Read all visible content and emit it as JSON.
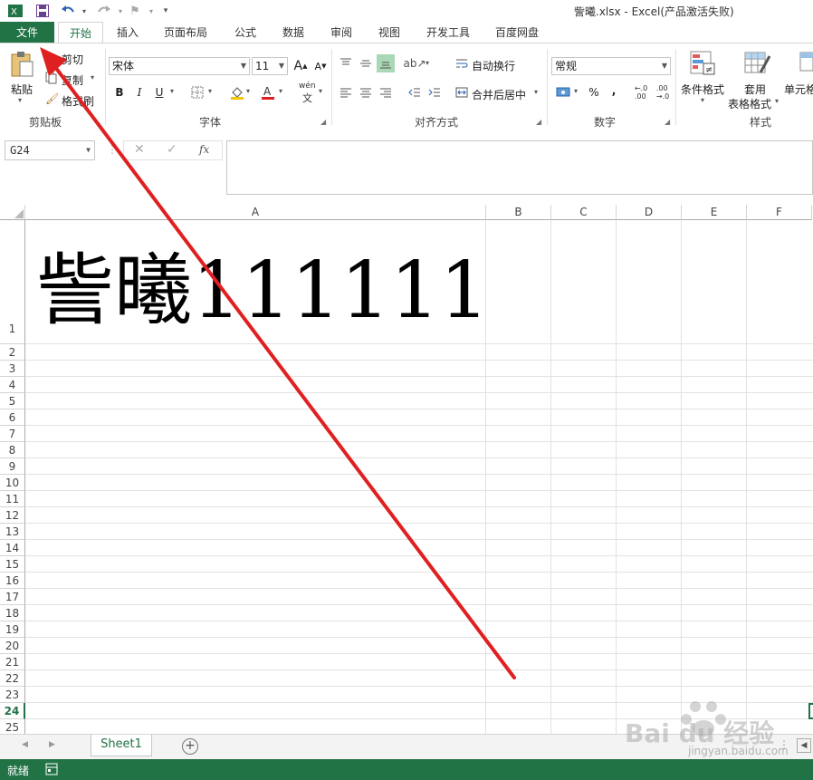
{
  "window": {
    "title": "訾曦.xlsx - Excel(产品激活失败)"
  },
  "quick_access": [
    "excel-logo-icon",
    "save-icon",
    "undo-icon",
    "redo-icon",
    "format-painter-qa-icon",
    "customize-icon"
  ],
  "tabs": [
    {
      "label": "文件"
    },
    {
      "label": "开始"
    },
    {
      "label": "插入"
    },
    {
      "label": "页面布局"
    },
    {
      "label": "公式"
    },
    {
      "label": "数据"
    },
    {
      "label": "审阅"
    },
    {
      "label": "视图"
    },
    {
      "label": "开发工具"
    },
    {
      "label": "百度网盘"
    }
  ],
  "ribbon": {
    "clipboard": {
      "paste": "粘贴",
      "cut": "剪切",
      "copy": "复制",
      "format_painter": "格式刷",
      "label": "剪贴板"
    },
    "font": {
      "name": "宋体",
      "size": "11",
      "grow": "A",
      "shrink": "A",
      "bold": "B",
      "italic": "I",
      "underline": "U",
      "wen": "wén",
      "label": "字体"
    },
    "alignment": {
      "wrap": "自动换行",
      "merge": "合并后居中",
      "label": "对齐方式"
    },
    "number": {
      "format": "常规",
      "percent": "%",
      "comma": ",",
      "label": "数字"
    },
    "styles": {
      "conditional": "条件格式",
      "table_line1": "套用",
      "table_line2": "表格格式",
      "cell": "单元格",
      "label": "样式"
    }
  },
  "formula_bar": {
    "name_box": "G24",
    "fx": "fx",
    "value": ""
  },
  "grid": {
    "columns": [
      "A",
      "B",
      "C",
      "D",
      "E",
      "F"
    ],
    "rows": [
      "1",
      "2",
      "3",
      "4",
      "5",
      "6",
      "7",
      "8",
      "9",
      "10",
      "11",
      "12",
      "13",
      "14",
      "15",
      "16",
      "17",
      "18",
      "19",
      "20",
      "21",
      "22",
      "23",
      "24",
      "25"
    ],
    "cell_A1": "訾曦111111",
    "active_row": "24"
  },
  "sheets": [
    {
      "name": "Sheet1"
    }
  ],
  "status": {
    "ready": "就绪"
  },
  "watermark": {
    "brand": "Bai du 经验",
    "url": "jingyan.baidu.com"
  },
  "colors": {
    "accent": "#217346",
    "arrow": "#e02020"
  }
}
